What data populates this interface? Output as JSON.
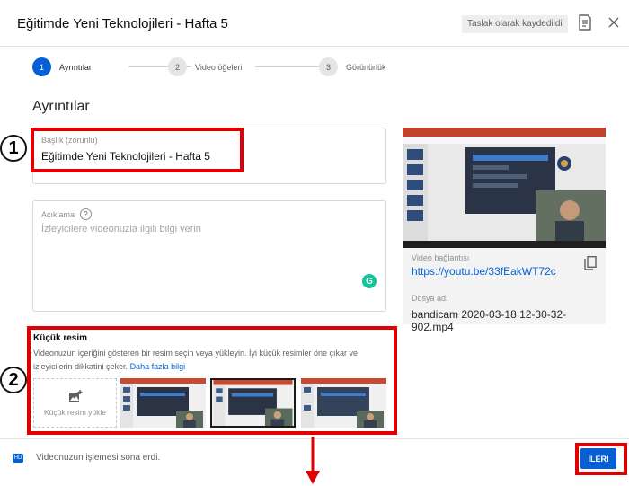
{
  "header": {
    "title": "Eğitimde Yeni Teknolojileri - Hafta 5",
    "draft_status": "Taslak olarak kaydedildi"
  },
  "stepper": {
    "steps": [
      {
        "number": "1",
        "label": "Ayrıntılar",
        "active": true
      },
      {
        "number": "2",
        "label": "Video öğeleri",
        "active": false
      },
      {
        "number": "3",
        "label": "Görünürlük",
        "active": false
      }
    ]
  },
  "main": {
    "section_title": "Ayrıntılar",
    "title_field": {
      "label": "Başlık (zorunlu)",
      "value": "Eğitimde Yeni Teknolojileri - Hafta 5"
    },
    "description_field": {
      "label": "Açıklama",
      "placeholder": "İzleyicilere videonuzla ilgili bilgi verin"
    },
    "thumbnail": {
      "title": "Küçük resim",
      "description": "Videonuzun içeriğini gösteren bir resim seçin veya yükleyin. İyi küçük resimler öne çıkar ve izleyicilerin dikkatini çeker.",
      "learn_more": "Daha fazla bilgi",
      "upload_label": "Küçük resim yükle"
    }
  },
  "annotations": {
    "badge_1": "1",
    "badge_2": "2"
  },
  "preview": {
    "link_label": "Video bağlantısı",
    "link": "https://youtu.be/33fEakWT72c",
    "filename_label": "Dosya adı",
    "filename": "bandicam 2020-03-18 12-30-32-902.mp4"
  },
  "footer": {
    "status": "Videonuzun işlemesi sona erdi.",
    "next_label": "İLERİ",
    "hd_badge": "HD"
  },
  "colors": {
    "accent": "#065fd4",
    "annotation_red": "#e00000",
    "grammarly": "#15c39a"
  },
  "icons": [
    "feedback-icon",
    "close-icon",
    "help-icon",
    "grammarly-icon",
    "add-photo-icon",
    "copy-icon",
    "hd-icon"
  ]
}
